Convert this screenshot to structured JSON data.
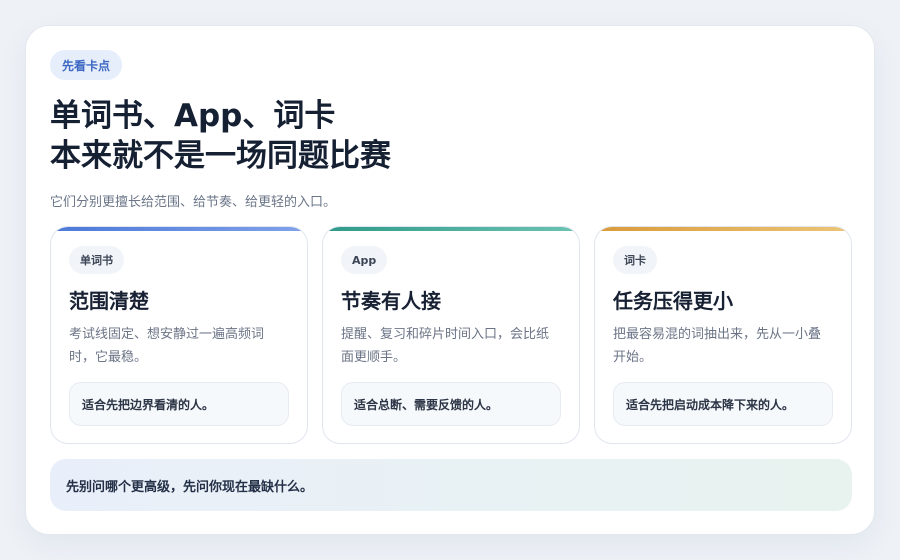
{
  "badge": "先看卡点",
  "title_line1": "单词书、App、词卡",
  "title_line2": "本来就不是一场同题比赛",
  "subtitle": "它们分别更擅长给范围、给节奏、给更轻的入口。",
  "columns": [
    {
      "tag": "单词书",
      "heading": "范围清楚",
      "description": "考试线固定、想安静过一遍高频词时，它最稳。",
      "note": "适合先把边界看清的人。",
      "accent_from": "#4c79d8",
      "accent_to": "#7fa2ea"
    },
    {
      "tag": "App",
      "heading": "节奏有人接",
      "description": "提醒、复习和碎片时间入口，会比纸面更顺手。",
      "note": "适合总断、需要反馈的人。",
      "accent_from": "#2f9a88",
      "accent_to": "#6bc3b3"
    },
    {
      "tag": "词卡",
      "heading": "任务压得更小",
      "description": "把最容易混的词抽出来，先从一小叠开始。",
      "note": "适合先把启动成本降下来的人。",
      "accent_from": "#d99a3a",
      "accent_to": "#ecc577"
    }
  ],
  "footer": "先别问哪个更高级，先问你现在最缺什么。"
}
